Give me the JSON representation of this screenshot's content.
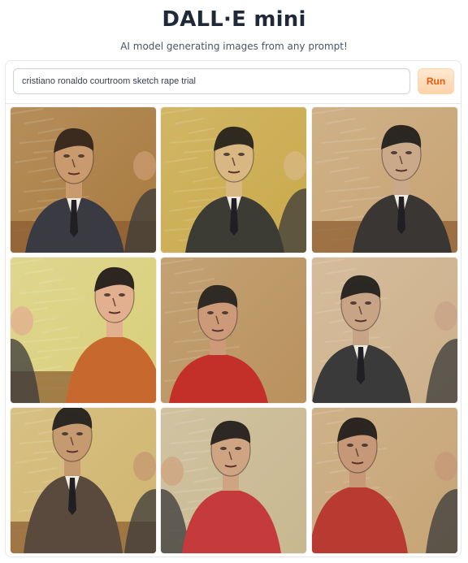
{
  "header": {
    "title": "DALL·E mini",
    "subtitle": "AI model generating images from any prompt!"
  },
  "prompt": {
    "value": "cristiano ronaldo courtroom sketch rape trial",
    "placeholder": ""
  },
  "run_button": {
    "label": "Run"
  },
  "colors": {
    "accent": "#ea580c",
    "button_bg": "#fdd3aa"
  },
  "results": {
    "count": 9,
    "images": [
      {
        "bg": "#a87a3e",
        "skin": "#c99a6e",
        "hair": "#3b2a1e",
        "shirt": "#3a3a42",
        "tone": "warm-brown"
      },
      {
        "bg": "#c9a94a",
        "skin": "#d8b782",
        "hair": "#2e2a20",
        "shirt": "#3c3c34",
        "tone": "yellow"
      },
      {
        "bg": "#c7a373",
        "skin": "#c9a98a",
        "hair": "#2a2622",
        "shirt": "#3a3634",
        "tone": "tan"
      },
      {
        "bg": "#d9cf7a",
        "skin": "#e2b08e",
        "hair": "#2d2620",
        "shirt": "#c7692e",
        "tone": "yellow-orange"
      },
      {
        "bg": "#b9915c",
        "skin": "#cc9a78",
        "hair": "#2f2a24",
        "shirt": "#c3302a",
        "tone": "red"
      },
      {
        "bg": "#cdb08a",
        "skin": "#c7a486",
        "hair": "#2b2824",
        "shirt": "#3a3a3a",
        "tone": "beige"
      },
      {
        "bg": "#d0b56e",
        "skin": "#c69a70",
        "hair": "#2b2722",
        "shirt": "#5a4a3e",
        "tone": "ochre"
      },
      {
        "bg": "#c8b890",
        "skin": "#cfa482",
        "hair": "#2d2823",
        "shirt": "#c53a3a",
        "tone": "red-pale"
      },
      {
        "bg": "#c6a475",
        "skin": "#c69878",
        "hair": "#2a2521",
        "shirt": "#b83a30",
        "tone": "red-tan"
      }
    ]
  }
}
